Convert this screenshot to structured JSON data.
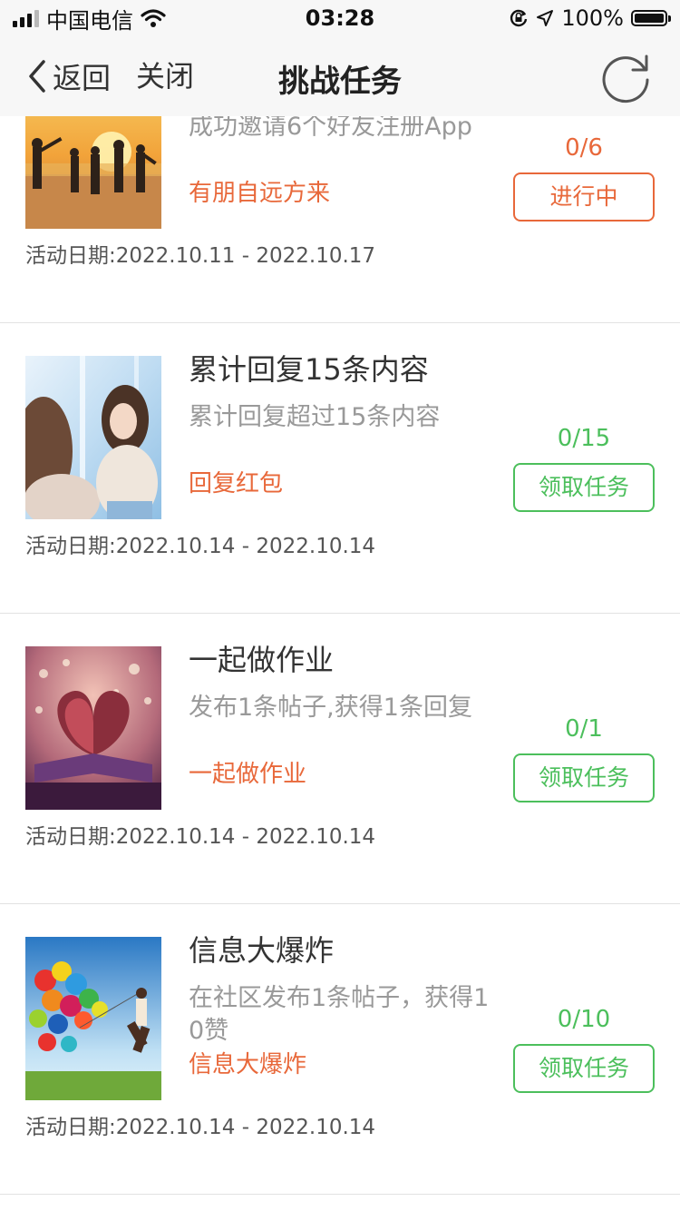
{
  "status_bar": {
    "carrier": "中国电信",
    "time": "03:28",
    "battery": "100%",
    "icons": [
      "signal-icon",
      "wifi-icon",
      "rotation-lock-icon",
      "location-icon",
      "battery-icon"
    ]
  },
  "nav": {
    "back_label": "返回",
    "close_label": "关闭",
    "title": "挑战任务",
    "icons": [
      "chevron-left-icon",
      "refresh-icon"
    ]
  },
  "colors": {
    "accent_orange": "#e8683a",
    "accent_green": "#4cbf5c",
    "bar_bg": "#f7f7f7"
  },
  "tasks": [
    {
      "title": "",
      "desc": "成功邀请6个好友注册App",
      "tag": "有朋自远方来",
      "date_label": "活动日期:",
      "date_range": "2022.10.11 - 2022.10.17",
      "progress": "0/6",
      "button": "进行中",
      "state": "active",
      "image": "friends-on-beach"
    },
    {
      "title": "累计回复15条内容",
      "desc": "累计回复超过15条内容",
      "tag": "回复红包",
      "date_label": "活动日期:",
      "date_range": "2022.10.14 - 2022.10.14",
      "progress": "0/15",
      "button": "领取任务",
      "state": "todo",
      "image": "two-girls-by-window"
    },
    {
      "title": "一起做作业",
      "desc": "发布1条帖子,获得1条回复",
      "tag": "一起做作业",
      "date_label": "活动日期:",
      "date_range": "2022.10.14 - 2022.10.14",
      "progress": "0/1",
      "button": "领取任务",
      "state": "todo",
      "image": "heart-shaped-book"
    },
    {
      "title": "信息大爆炸",
      "desc": "在社区发布1条帖子，获得10赞",
      "tag": "信息大爆炸",
      "date_label": "活动日期:",
      "date_range": "2022.10.14 - 2022.10.14",
      "progress": "0/10",
      "button": "领取任务",
      "state": "todo",
      "image": "child-with-balloons"
    }
  ]
}
